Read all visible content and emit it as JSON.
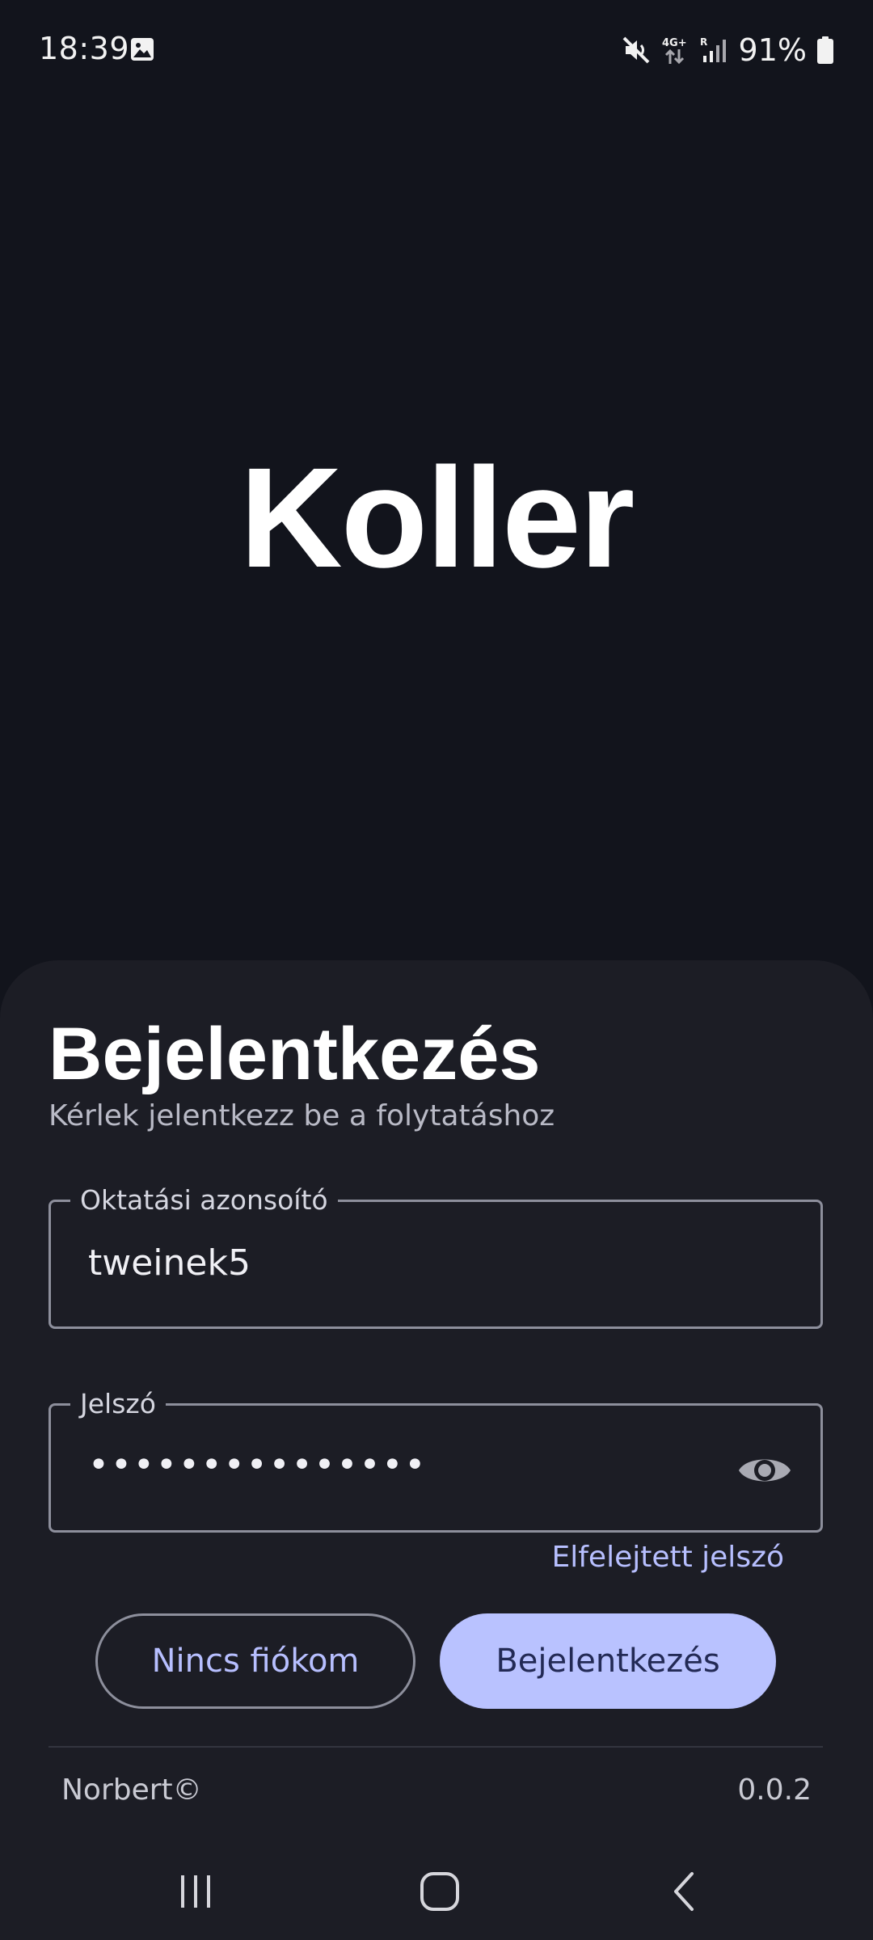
{
  "status_bar": {
    "time": "18:39",
    "battery": "91%",
    "icons": [
      "gallery-icon",
      "mute-icon",
      "4g-data-icon",
      "signal-icon",
      "battery-icon"
    ]
  },
  "app": {
    "title": "Koller"
  },
  "login": {
    "heading": "Bejelentkezés",
    "subtitle": "Kérlek jelentkezz be a folytatáshoz",
    "id_field": {
      "label": "Oktatási azonsoító",
      "value": "tweinek5"
    },
    "password_field": {
      "label": "Jelszó",
      "masked_value": "•••••••••••••••",
      "toggle_icon": "eye-icon"
    },
    "forgot_password": "Elfelejtett jelszó",
    "no_account_button": "Nincs fiókom",
    "login_button": "Bejelentkezés"
  },
  "footer": {
    "author": "Norbert©",
    "version": "0.0.2"
  },
  "colors": {
    "background": "#12141c",
    "sheet": "#1c1d25",
    "accent": "#b9c2ff",
    "accent_text": "#b7bfff",
    "outline": "#8d8f9c"
  },
  "navigation": {
    "icons": [
      "recents-icon",
      "home-icon",
      "back-icon"
    ]
  }
}
